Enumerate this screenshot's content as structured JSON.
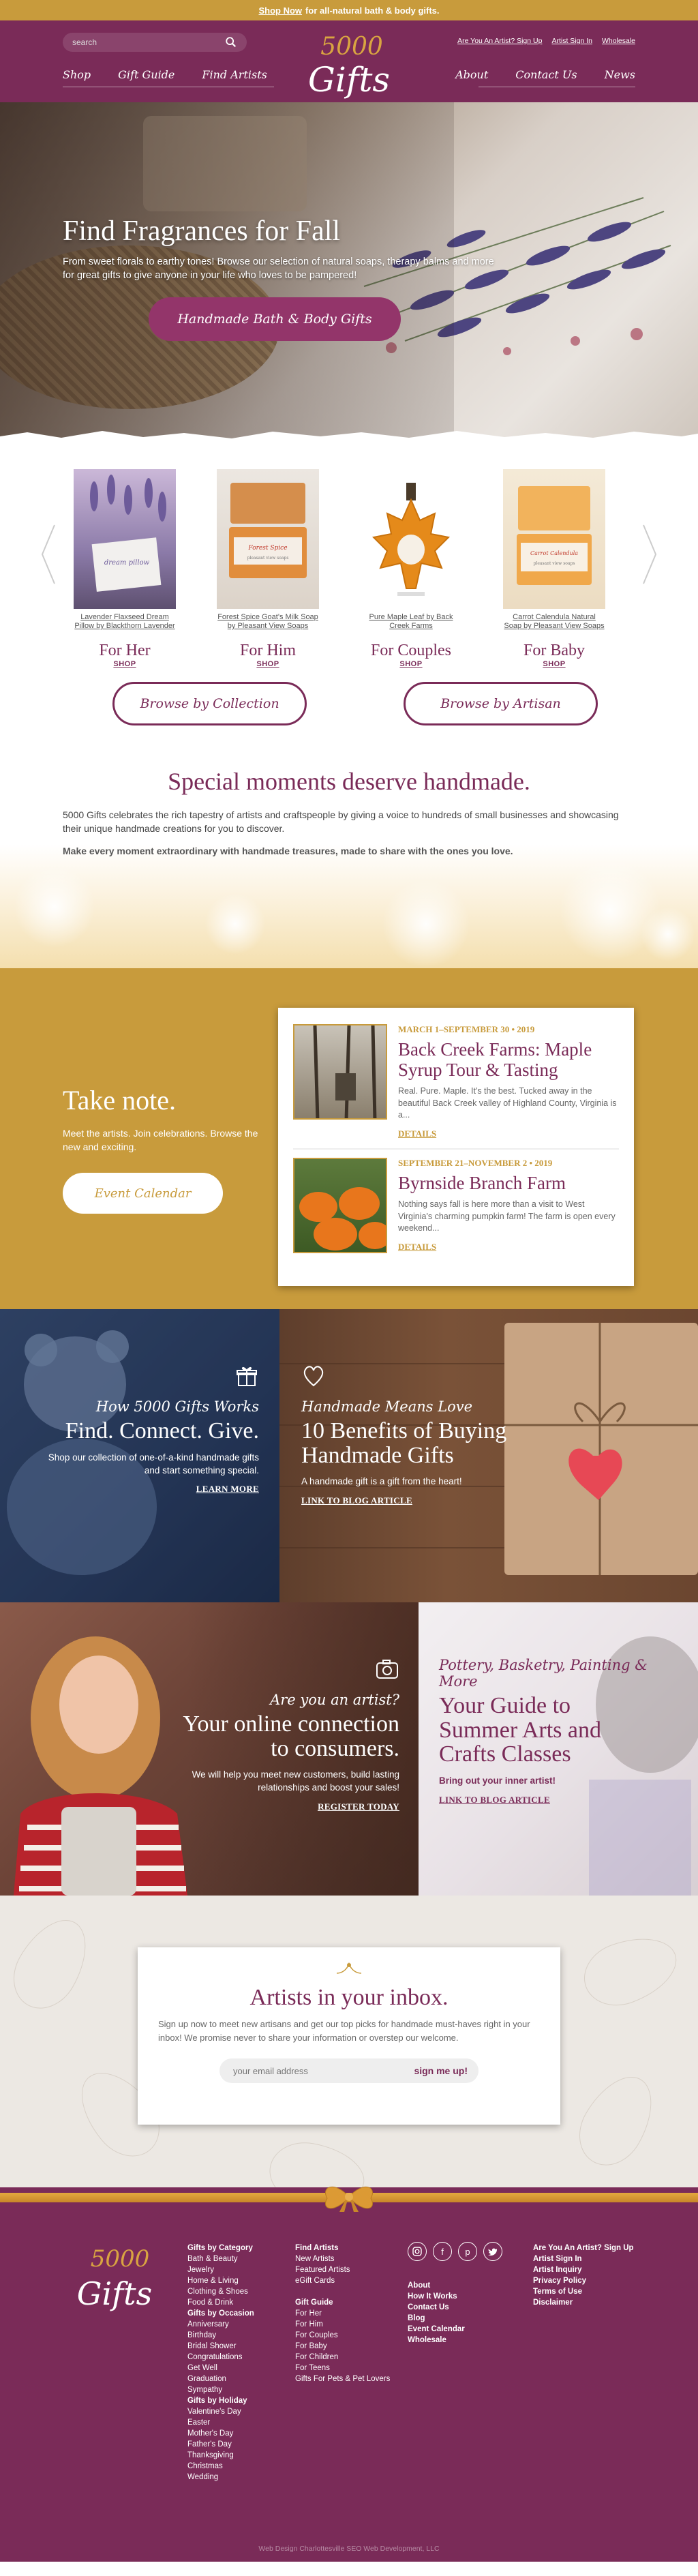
{
  "topbar": {
    "link": "Shop Now",
    "text": "for all-natural bath & body gifts."
  },
  "header": {
    "search_placeholder": "search",
    "nav_left": [
      "Shop",
      "Gift Guide",
      "Find Artists"
    ],
    "nav_right": [
      "About",
      "Contact Us",
      "News"
    ],
    "top_links": [
      "Are You An Artist? Sign Up",
      "Artist Sign In",
      "Wholesale"
    ],
    "logo_number": "5000",
    "logo_word": "Gifts"
  },
  "hero": {
    "title": "Find Fragrances for Fall",
    "text": "From sweet florals to earthy tones! Browse our selection of natural soaps, therapy balms and more for great gifts to give anyone in your life who loves to be pampered!",
    "button": "Handmade Bath & Body Gifts"
  },
  "products": [
    {
      "name": "Lavender Flaxseed Dream Pillow by Blackthorn Lavender",
      "category": "For Her",
      "shop": "SHOP"
    },
    {
      "name": "Forest Spice Goat's Milk Soap by Pleasant View Soaps",
      "category": "For Him",
      "shop": "SHOP"
    },
    {
      "name": "Pure Maple Leaf by Back Creek Farms",
      "category": "For Couples",
      "shop": "SHOP"
    },
    {
      "name": "Carrot Calendula Natural Soap by Pleasant View Soaps",
      "category": "For Baby",
      "shop": "SHOP"
    }
  ],
  "product_labels": {
    "lavender_card": "dream pillow",
    "soap_label": "Forest Spice",
    "soap_small": "pleasant view soaps",
    "carrot_label": "Carrot Calendula",
    "carrot_small": "pleasant view soaps"
  },
  "browse": {
    "collection": "Browse by Collection",
    "artisan": "Browse by Artisan"
  },
  "special": {
    "title": "Special moments deserve handmade.",
    "text": "5000 Gifts celebrates the rich tapestry of artists and craftspeople by giving a voice to hundreds of small businesses and showcasing their unique handmade creations for you to discover.",
    "bold": "Make every moment extraordinary with handmade treasures, made to share with the ones you love."
  },
  "takenote": {
    "title": "Take note.",
    "text": "Meet the artists. Join celebrations. Browse the new and exciting.",
    "button": "Event Calendar",
    "events": [
      {
        "date": "MARCH 1–SEPTEMBER 30 • 2019",
        "title": "Back Creek Farms: Maple Syrup Tour & Tasting",
        "desc": "Real. Pure. Maple.  It's the best. Tucked away in the beautiful Back Creek valley of Highland County, Virginia is a...",
        "link": "DETAILS"
      },
      {
        "date": "SEPTEMBER 21–NOVEMBER 2 • 2019",
        "title": "Byrnside Branch Farm",
        "desc": "Nothing says fall is here more than a visit to West Virginia's charming pumpkin farm! The farm is open every weekend...",
        "link": "DETAILS"
      }
    ]
  },
  "how": {
    "script": "How 5000 Gifts Works",
    "heading": "Find. Connect. Give.",
    "text": "Shop our collection of one-of-a-kind handmade gifts and start something special.",
    "link": "LEARN MORE"
  },
  "benefits": {
    "script": "Handmade Means Love",
    "heading": "10 Benefits of Buying Handmade Gifts",
    "text": "A handmade gift is a gift from the heart!",
    "link": "LINK TO BLOG ARTICLE"
  },
  "artist": {
    "script": "Are you an artist?",
    "heading": "Your online connection to consumers.",
    "text": "We will help you meet new customers, build lasting relationships and boost your sales!",
    "link": "REGISTER TODAY"
  },
  "classes": {
    "script": "Pottery, Basketry, Painting & More",
    "heading": "Your Guide to Summer Arts and Crafts Classes",
    "text": "Bring out your inner artist!",
    "link": "LINK TO BLOG ARTICLE"
  },
  "newsletter": {
    "title": "Artists in your inbox.",
    "text": "Sign up now to meet new artisans and get our top picks for handmade must-haves right in your inbox! We promise never to share your information or overstep our welcome.",
    "placeholder": "your email address",
    "button": "sign me up!"
  },
  "footer": {
    "col1": [
      {
        "label": "Gifts by Category",
        "bold": true
      },
      {
        "label": "Bath & Beauty"
      },
      {
        "label": "Jewelry"
      },
      {
        "label": "Home & Living"
      },
      {
        "label": "Clothing & Shoes"
      },
      {
        "label": "Food & Drink"
      },
      {
        "label": "Gifts by Occasion",
        "bold": true
      },
      {
        "label": "Anniversary"
      },
      {
        "label": "Birthday"
      },
      {
        "label": "Bridal Shower"
      },
      {
        "label": "Congratulations"
      },
      {
        "label": "Get Well"
      },
      {
        "label": "Graduation"
      },
      {
        "label": "Sympathy"
      },
      {
        "label": "Gifts by Holiday",
        "bold": true
      },
      {
        "label": "Valentine's Day"
      },
      {
        "label": "Easter"
      },
      {
        "label": "Mother's Day"
      },
      {
        "label": "Father's Day"
      },
      {
        "label": "Thanksgiving"
      },
      {
        "label": "Christmas"
      },
      {
        "label": "Wedding"
      }
    ],
    "col2": [
      {
        "label": "Find Artists",
        "bold": true
      },
      {
        "label": "New Artists"
      },
      {
        "label": "Featured Artists"
      },
      {
        "label": "eGift Cards"
      },
      {
        "label": ""
      },
      {
        "label": "Gift Guide",
        "bold": true
      },
      {
        "label": "For Her"
      },
      {
        "label": "For Him"
      },
      {
        "label": "For Couples"
      },
      {
        "label": "For Baby"
      },
      {
        "label": "For Children"
      },
      {
        "label": "For Teens"
      },
      {
        "label": "Gifts For Pets & Pet Lovers"
      }
    ],
    "col3": [
      {
        "label": "About",
        "bold": true
      },
      {
        "label": "How It Works",
        "bold": true
      },
      {
        "label": "Contact Us",
        "bold": true
      },
      {
        "label": "Blog",
        "bold": true
      },
      {
        "label": "Event Calendar",
        "bold": true
      },
      {
        "label": "Wholesale",
        "bold": true
      }
    ],
    "col4": [
      {
        "label": "Are You An Artist? Sign Up",
        "bold": true
      },
      {
        "label": "Artist Sign In",
        "bold": true
      },
      {
        "label": "Artist Inquiry",
        "bold": true
      },
      {
        "label": "Privacy Policy",
        "bold": true
      },
      {
        "label": "Terms of Use",
        "bold": true
      },
      {
        "label": "Disclaimer",
        "bold": true
      }
    ],
    "social": [
      "instagram-icon",
      "facebook-icon",
      "pinterest-icon",
      "twitter-icon"
    ],
    "credit": "Web Design Charlottesville SEO Web Development, LLC"
  },
  "colors": {
    "plum": "#7a2b58",
    "gold": "#c89b3c",
    "button_plum": "#93356a"
  }
}
